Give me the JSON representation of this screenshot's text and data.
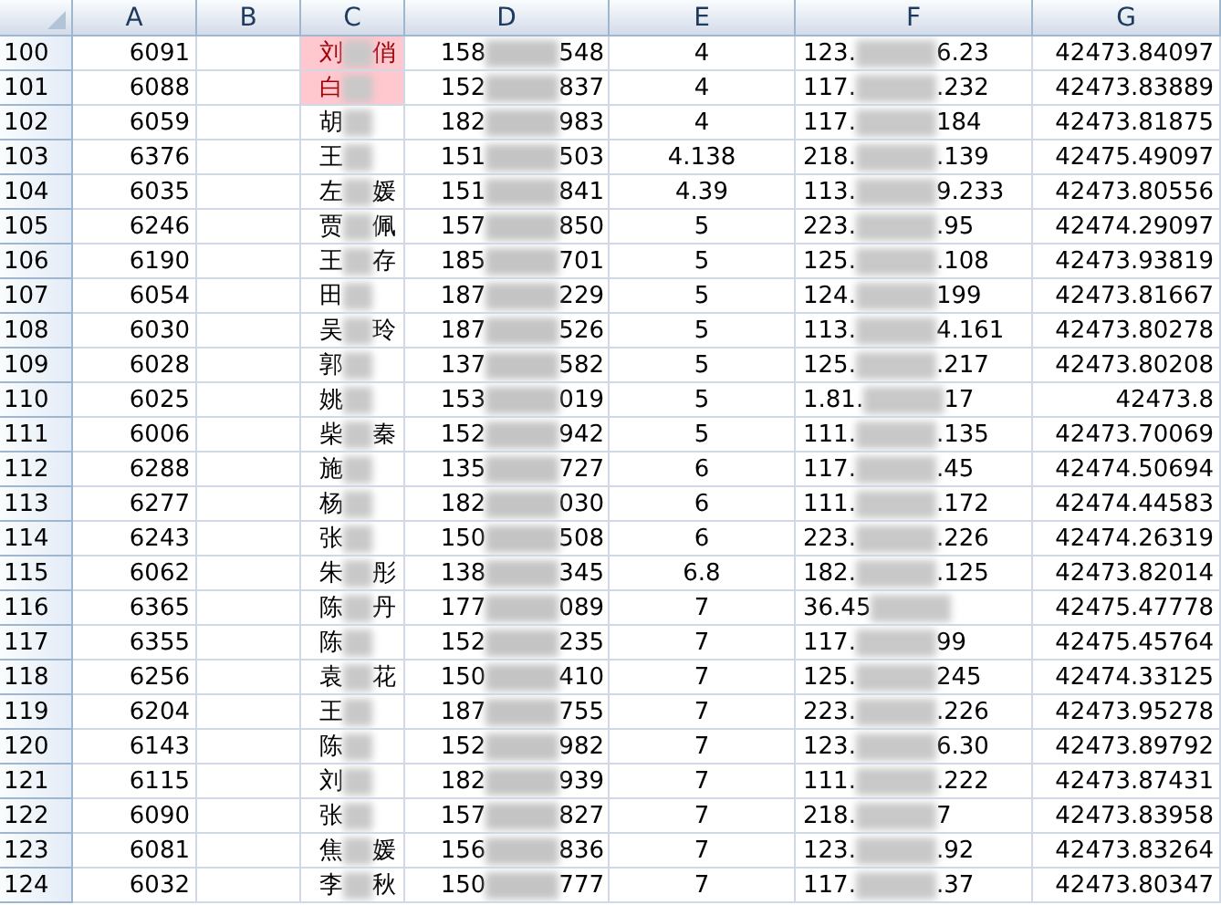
{
  "columns": [
    "A",
    "B",
    "C",
    "D",
    "E",
    "F",
    "G"
  ],
  "rows": [
    {
      "num": "100",
      "a": "6091",
      "name": [
        "刘",
        "俏"
      ],
      "highlighted": true,
      "phone": [
        "158",
        "548"
      ],
      "e": "4",
      "ip": [
        "123.",
        "6.23"
      ],
      "g": "42473.84097"
    },
    {
      "num": "101",
      "a": "6088",
      "name": [
        "白"
      ],
      "highlighted": true,
      "phone": [
        "152",
        "837"
      ],
      "e": "4",
      "ip": [
        "117.",
        ".232"
      ],
      "g": "42473.83889"
    },
    {
      "num": "102",
      "a": "6059",
      "name": [
        "胡"
      ],
      "highlighted": false,
      "phone": [
        "182",
        "983"
      ],
      "e": "4",
      "ip": [
        "117.",
        "184"
      ],
      "g": "42473.81875"
    },
    {
      "num": "103",
      "a": "6376",
      "name": [
        "王"
      ],
      "highlighted": false,
      "phone": [
        "151",
        "503"
      ],
      "e": "4.138",
      "ip": [
        "218.",
        ".139"
      ],
      "g": "42475.49097"
    },
    {
      "num": "104",
      "a": "6035",
      "name": [
        "左",
        "媛"
      ],
      "highlighted": false,
      "phone": [
        "151",
        "841"
      ],
      "e": "4.39",
      "ip": [
        "113.",
        "9.233"
      ],
      "g": "42473.80556"
    },
    {
      "num": "105",
      "a": "6246",
      "name": [
        "贾",
        "佩"
      ],
      "highlighted": false,
      "phone": [
        "157",
        "850"
      ],
      "e": "5",
      "ip": [
        "223.",
        ".95"
      ],
      "g": "42474.29097"
    },
    {
      "num": "106",
      "a": "6190",
      "name": [
        "王",
        "存"
      ],
      "highlighted": false,
      "phone": [
        "185",
        "701"
      ],
      "e": "5",
      "ip": [
        "125.",
        ".108"
      ],
      "g": "42473.93819"
    },
    {
      "num": "107",
      "a": "6054",
      "name": [
        "田"
      ],
      "highlighted": false,
      "phone": [
        "187",
        "229"
      ],
      "e": "5",
      "ip": [
        "124.",
        "199"
      ],
      "g": "42473.81667"
    },
    {
      "num": "108",
      "a": "6030",
      "name": [
        "吴",
        "玲"
      ],
      "highlighted": false,
      "phone": [
        "187",
        "526"
      ],
      "e": "5",
      "ip": [
        "113.",
        "4.161"
      ],
      "g": "42473.80278"
    },
    {
      "num": "109",
      "a": "6028",
      "name": [
        "郭"
      ],
      "highlighted": false,
      "phone": [
        "137",
        "582"
      ],
      "e": "5",
      "ip": [
        "125.",
        ".217"
      ],
      "g": "42473.80208"
    },
    {
      "num": "110",
      "a": "6025",
      "name": [
        "姚"
      ],
      "highlighted": false,
      "phone": [
        "153",
        "019"
      ],
      "e": "5",
      "ip": [
        "1.81.",
        "17"
      ],
      "g": "42473.8"
    },
    {
      "num": "111",
      "a": "6006",
      "name": [
        "柴",
        "秦"
      ],
      "highlighted": false,
      "phone": [
        "152",
        "942"
      ],
      "e": "5",
      "ip": [
        "111.",
        ".135"
      ],
      "g": "42473.70069"
    },
    {
      "num": "112",
      "a": "6288",
      "name": [
        "施"
      ],
      "highlighted": false,
      "phone": [
        "135",
        "727"
      ],
      "e": "6",
      "ip": [
        "117.",
        ".45"
      ],
      "g": "42474.50694"
    },
    {
      "num": "113",
      "a": "6277",
      "name": [
        "杨"
      ],
      "highlighted": false,
      "phone": [
        "182",
        "030"
      ],
      "e": "6",
      "ip": [
        "111.",
        ".172"
      ],
      "g": "42474.44583"
    },
    {
      "num": "114",
      "a": "6243",
      "name": [
        "张"
      ],
      "highlighted": false,
      "phone": [
        "150",
        "508"
      ],
      "e": "6",
      "ip": [
        "223.",
        ".226"
      ],
      "g": "42474.26319"
    },
    {
      "num": "115",
      "a": "6062",
      "name": [
        "朱",
        "彤"
      ],
      "highlighted": false,
      "phone": [
        "138",
        "345"
      ],
      "e": "6.8",
      "ip": [
        "182.",
        ".125"
      ],
      "g": "42473.82014"
    },
    {
      "num": "116",
      "a": "6365",
      "name": [
        "陈",
        "丹"
      ],
      "highlighted": false,
      "phone": [
        "177",
        "089"
      ],
      "e": "7",
      "ip": [
        "36.45"
      ],
      "g": "42475.47778"
    },
    {
      "num": "117",
      "a": "6355",
      "name": [
        "陈"
      ],
      "highlighted": false,
      "phone": [
        "152",
        "235"
      ],
      "e": "7",
      "ip": [
        "117.",
        "99"
      ],
      "g": "42475.45764"
    },
    {
      "num": "118",
      "a": "6256",
      "name": [
        "袁",
        "花"
      ],
      "highlighted": false,
      "phone": [
        "150",
        "410"
      ],
      "e": "7",
      "ip": [
        "125.",
        "245"
      ],
      "g": "42474.33125"
    },
    {
      "num": "119",
      "a": "6204",
      "name": [
        "王"
      ],
      "highlighted": false,
      "phone": [
        "187",
        "755"
      ],
      "e": "7",
      "ip": [
        "223.",
        ".226"
      ],
      "g": "42473.95278"
    },
    {
      "num": "120",
      "a": "6143",
      "name": [
        "陈"
      ],
      "highlighted": false,
      "phone": [
        "152",
        "982"
      ],
      "e": "7",
      "ip": [
        "123.",
        "6.30"
      ],
      "g": "42473.89792"
    },
    {
      "num": "121",
      "a": "6115",
      "name": [
        "刘"
      ],
      "highlighted": false,
      "phone": [
        "182",
        "939"
      ],
      "e": "7",
      "ip": [
        "111.",
        ".222"
      ],
      "g": "42473.87431"
    },
    {
      "num": "122",
      "a": "6090",
      "name": [
        "张"
      ],
      "highlighted": false,
      "phone": [
        "157",
        "827"
      ],
      "e": "7",
      "ip": [
        "218.",
        "7"
      ],
      "g": "42473.83958"
    },
    {
      "num": "123",
      "a": "6081",
      "name": [
        "焦",
        "媛"
      ],
      "highlighted": false,
      "phone": [
        "156",
        "836"
      ],
      "e": "7",
      "ip": [
        "123.",
        ".92"
      ],
      "g": "42473.83264"
    },
    {
      "num": "124",
      "a": "6032",
      "name": [
        "李",
        "秋"
      ],
      "highlighted": false,
      "phone": [
        "150",
        "777"
      ],
      "e": "7",
      "ip": [
        "117.",
        ".37"
      ],
      "g": "42473.80347"
    }
  ]
}
